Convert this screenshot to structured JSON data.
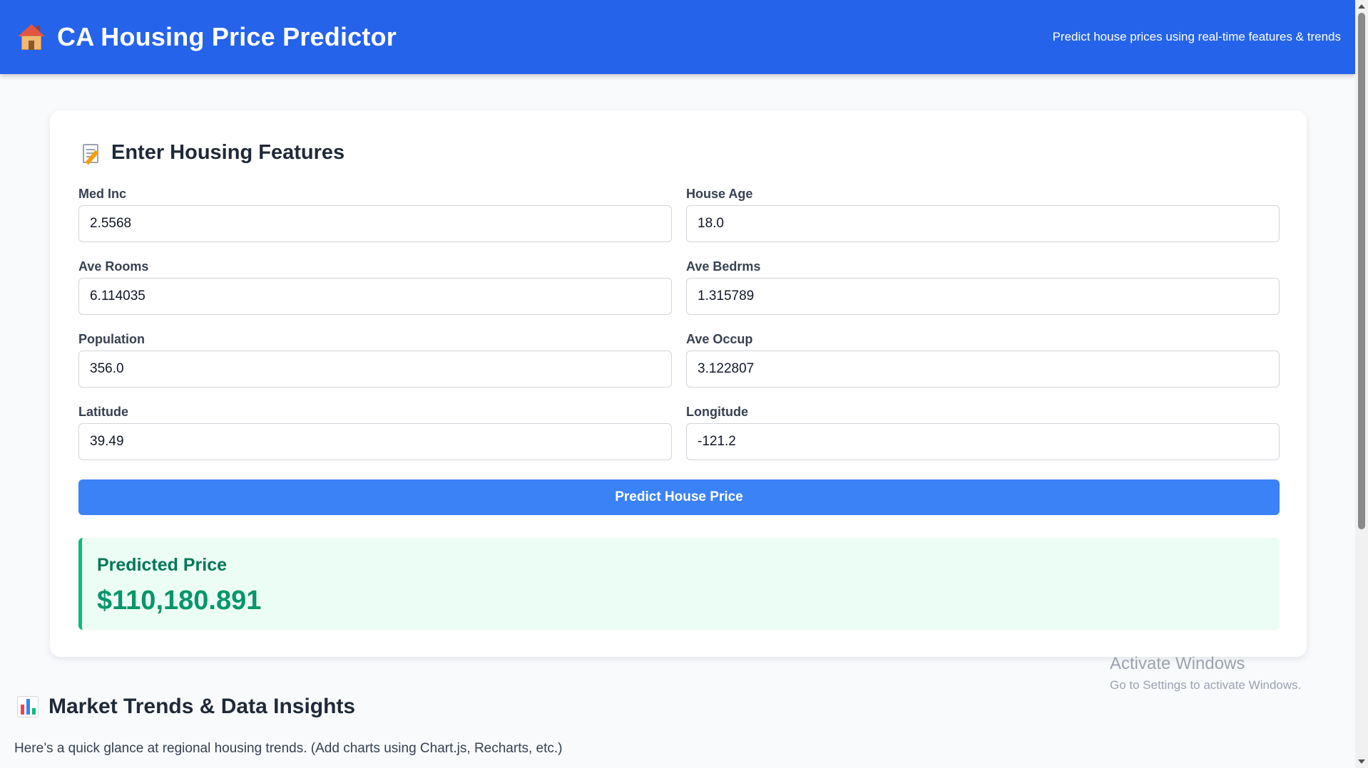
{
  "header": {
    "title": "CA Housing Price Predictor",
    "tagline": "Predict house prices using real-time features & trends",
    "icon": "house-icon"
  },
  "form": {
    "title": "Enter Housing Features",
    "icon": "memo-icon",
    "fields": [
      {
        "label": "Med Inc",
        "value": "2.5568"
      },
      {
        "label": "House Age",
        "value": "18.0"
      },
      {
        "label": "Ave Rooms",
        "value": "6.114035"
      },
      {
        "label": "Ave Bedrms",
        "value": "1.315789"
      },
      {
        "label": "Population",
        "value": "356.0"
      },
      {
        "label": "Ave Occup",
        "value": "3.122807"
      },
      {
        "label": "Latitude",
        "value": "39.49"
      },
      {
        "label": "Longitude",
        "value": "-121.2"
      }
    ],
    "submit_label": "Predict House Price"
  },
  "result": {
    "label": "Predicted Price",
    "value": "$110,180.891"
  },
  "market": {
    "title": "Market Trends & Data Insights",
    "icon": "bar-chart-icon",
    "description": "Here’s a quick glance at regional housing trends. (Add charts using Chart.js, Recharts, etc.)"
  },
  "watermark": {
    "title": "Activate Windows",
    "subtitle": "Go to Settings to activate Windows."
  },
  "colors": {
    "header_bg": "#2563eb",
    "button_bg": "#3b82f6",
    "result_bg": "#ecfdf5",
    "result_accent": "#10b981",
    "result_text": "#047857"
  }
}
